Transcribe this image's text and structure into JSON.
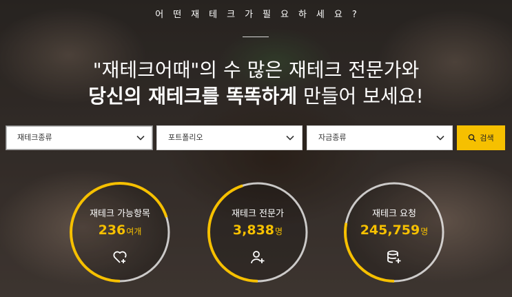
{
  "hero": {
    "tagline": "어떤재테크가필요하세요?",
    "headline_line1": "\"재테크어때\"의 수 많은 재테크 전문가와",
    "headline_line2_strong": "당신의 재테크를 똑똑하게",
    "headline_line2_rest": " 만들어 보세요!"
  },
  "filters": {
    "type_select": "재테크종류",
    "portfolio_select": "포트폴리오",
    "fund_select": "자금종류",
    "search_label": "검색"
  },
  "stats": [
    {
      "label": "재테크 가능항목",
      "value": "236",
      "unit": "여개",
      "icon": "heart-plus-icon",
      "progress": 0.7
    },
    {
      "label": "재테크 전문가",
      "value": "3,838",
      "unit": "명",
      "icon": "user-plus-icon",
      "progress": 0.45
    },
    {
      "label": "재테크 요청",
      "value": "245,759",
      "unit": "명",
      "icon": "database-plus-icon",
      "progress": 0.28
    }
  ],
  "colors": {
    "accent": "#f6c000",
    "text": "#ffffff"
  }
}
